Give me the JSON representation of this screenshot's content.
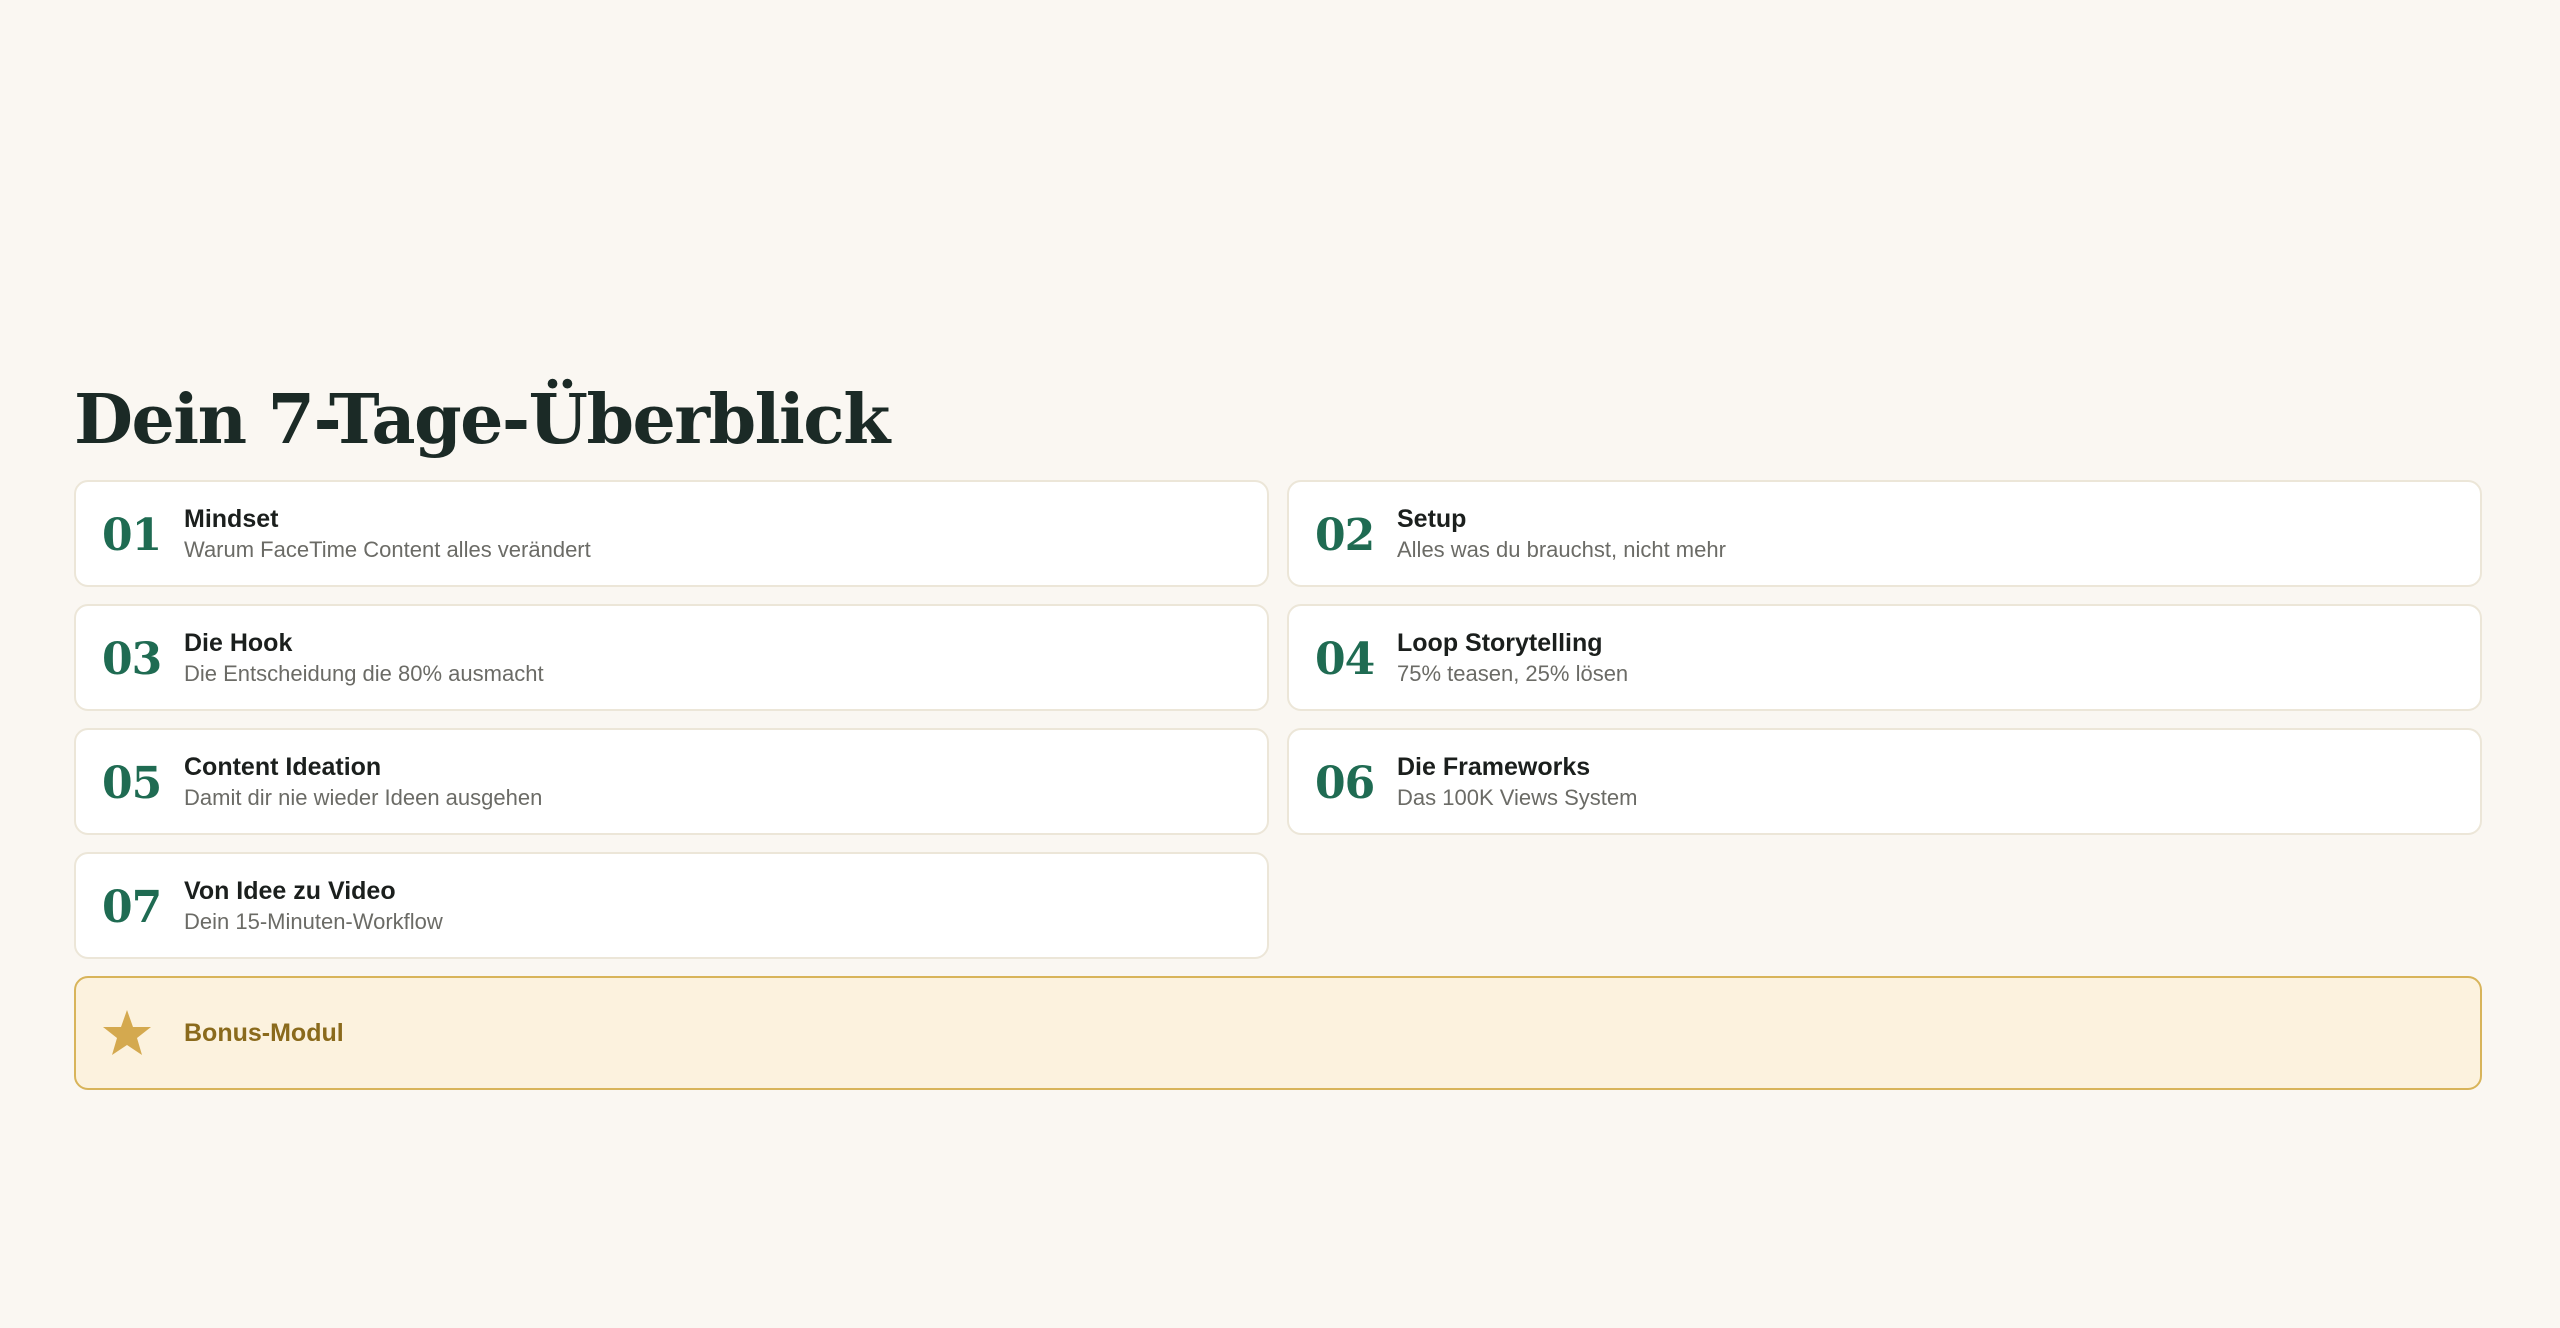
{
  "page": {
    "title": "Dein 7-Tage-Überblick"
  },
  "modules": [
    {
      "number": "01",
      "title": "Mindset",
      "subtitle": "Warum FaceTime Content alles verändert"
    },
    {
      "number": "02",
      "title": "Setup",
      "subtitle": "Alles was du brauchst, nicht mehr"
    },
    {
      "number": "03",
      "title": "Die Hook",
      "subtitle": "Die Entscheidung die 80% ausmacht"
    },
    {
      "number": "04",
      "title": "Loop Storytelling",
      "subtitle": "75% teasen, 25% lösen"
    },
    {
      "number": "05",
      "title": "Content Ideation",
      "subtitle": "Damit dir nie wieder Ideen ausgehen"
    },
    {
      "number": "06",
      "title": "Die Frameworks",
      "subtitle": "Das 100K Views System"
    },
    {
      "number": "07",
      "title": "Von Idee zu Video",
      "subtitle": "Dein 15-Minuten-Workflow"
    }
  ],
  "bonus": {
    "icon": "star-icon",
    "label": "Bonus-Modul"
  },
  "colors": {
    "background": "#faf7f2",
    "accent_green": "#1f6b52",
    "bonus_gold": "#d8b45a",
    "bonus_bg": "#fcf2de",
    "bonus_text": "#8a6a1c"
  }
}
